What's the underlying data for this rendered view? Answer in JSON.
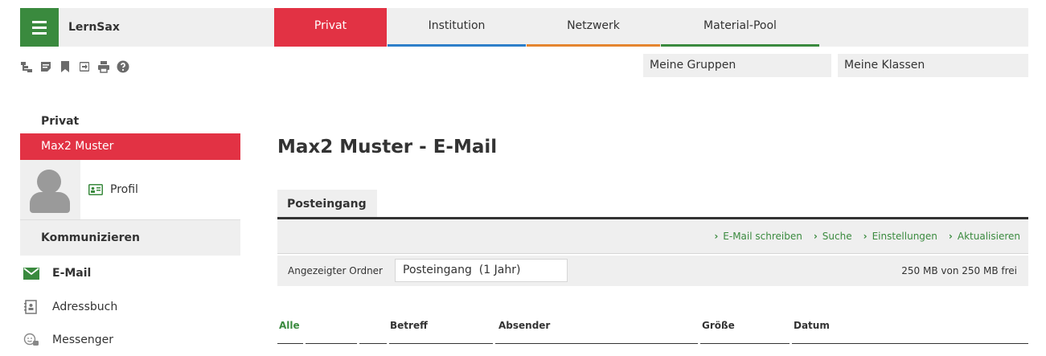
{
  "app": {
    "name": "LernSax"
  },
  "tabs": [
    {
      "label": "Privat",
      "active": true,
      "color": "#e23244"
    },
    {
      "label": "Institution",
      "active": false,
      "color": "#2d7fc9"
    },
    {
      "label": "Netzwerk",
      "active": false,
      "color": "#e5852f"
    },
    {
      "label": "Material-Pool",
      "active": false,
      "color": "#3a8a3e"
    }
  ],
  "toolbar": {
    "icons": [
      "sitemap-icon",
      "notes-icon",
      "bookmark-icon",
      "logout-icon",
      "print-icon",
      "help-icon"
    ]
  },
  "quick_links": {
    "groups": "Meine Gruppen",
    "classes": "Meine Klassen"
  },
  "sidebar": {
    "title": "Privat",
    "user": "Max2 Muster",
    "profile_label": "Profil",
    "section": "Kommunizieren",
    "items": [
      {
        "label": "E-Mail",
        "icon": "envelope-icon",
        "active": true
      },
      {
        "label": "Adressbuch",
        "icon": "addressbook-icon",
        "active": false
      },
      {
        "label": "Messenger",
        "icon": "messenger-icon",
        "active": false
      }
    ]
  },
  "main": {
    "title": "Max2 Muster - E-Mail",
    "tab": "Posteingang",
    "actions": [
      "E-Mail schreiben",
      "Suche",
      "Einstellungen",
      "Aktualisieren"
    ],
    "folder_label": "Angezeigter Ordner",
    "folder_value": "Posteingang  (1 Jahr)",
    "quota": "250 MB von 250 MB frei",
    "columns": [
      "Alle",
      "Betreff",
      "Absender",
      "Größe",
      "Datum"
    ]
  },
  "colors": {
    "accent_red": "#e23244",
    "accent_green": "#3a8a3e",
    "panel_gray": "#efefef"
  }
}
